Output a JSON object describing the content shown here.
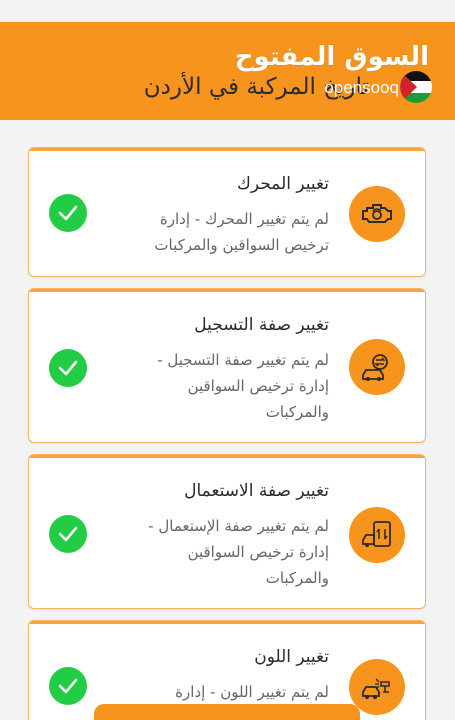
{
  "header": {
    "title": "تاريخ المركبة في الأردن",
    "watermark_arabic": "السوق المفتوح",
    "watermark_latin": "opensooq"
  },
  "colors": {
    "accent": "#f7941d",
    "check": "#22cc44",
    "card_border": "#f5b463"
  },
  "cards": [
    {
      "title": "تغيير المحرك",
      "description": "لم يتم تغيير المحرك - إدارة ترخيص السواقين والمركبات",
      "icon": "engine-icon",
      "status": "check-icon"
    },
    {
      "title": "تغيير صفة التسجيل",
      "description": "لم يتم تغيير صفة التسجيل - إدارة ترخيص السواقين والمركبات",
      "icon": "registration-change-icon",
      "status": "check-icon"
    },
    {
      "title": "تغيير صفة الاستعمال",
      "description": "لم يتم تغيير صفة الإستعمال - إدارة ترخيص السواقين والمركبات",
      "icon": "usage-document-icon",
      "status": "check-icon"
    },
    {
      "title": "تغيير اللون",
      "description": "لم يتم تغيير اللون - إدارة",
      "icon": "paint-spray-icon",
      "status": "check-icon"
    }
  ]
}
